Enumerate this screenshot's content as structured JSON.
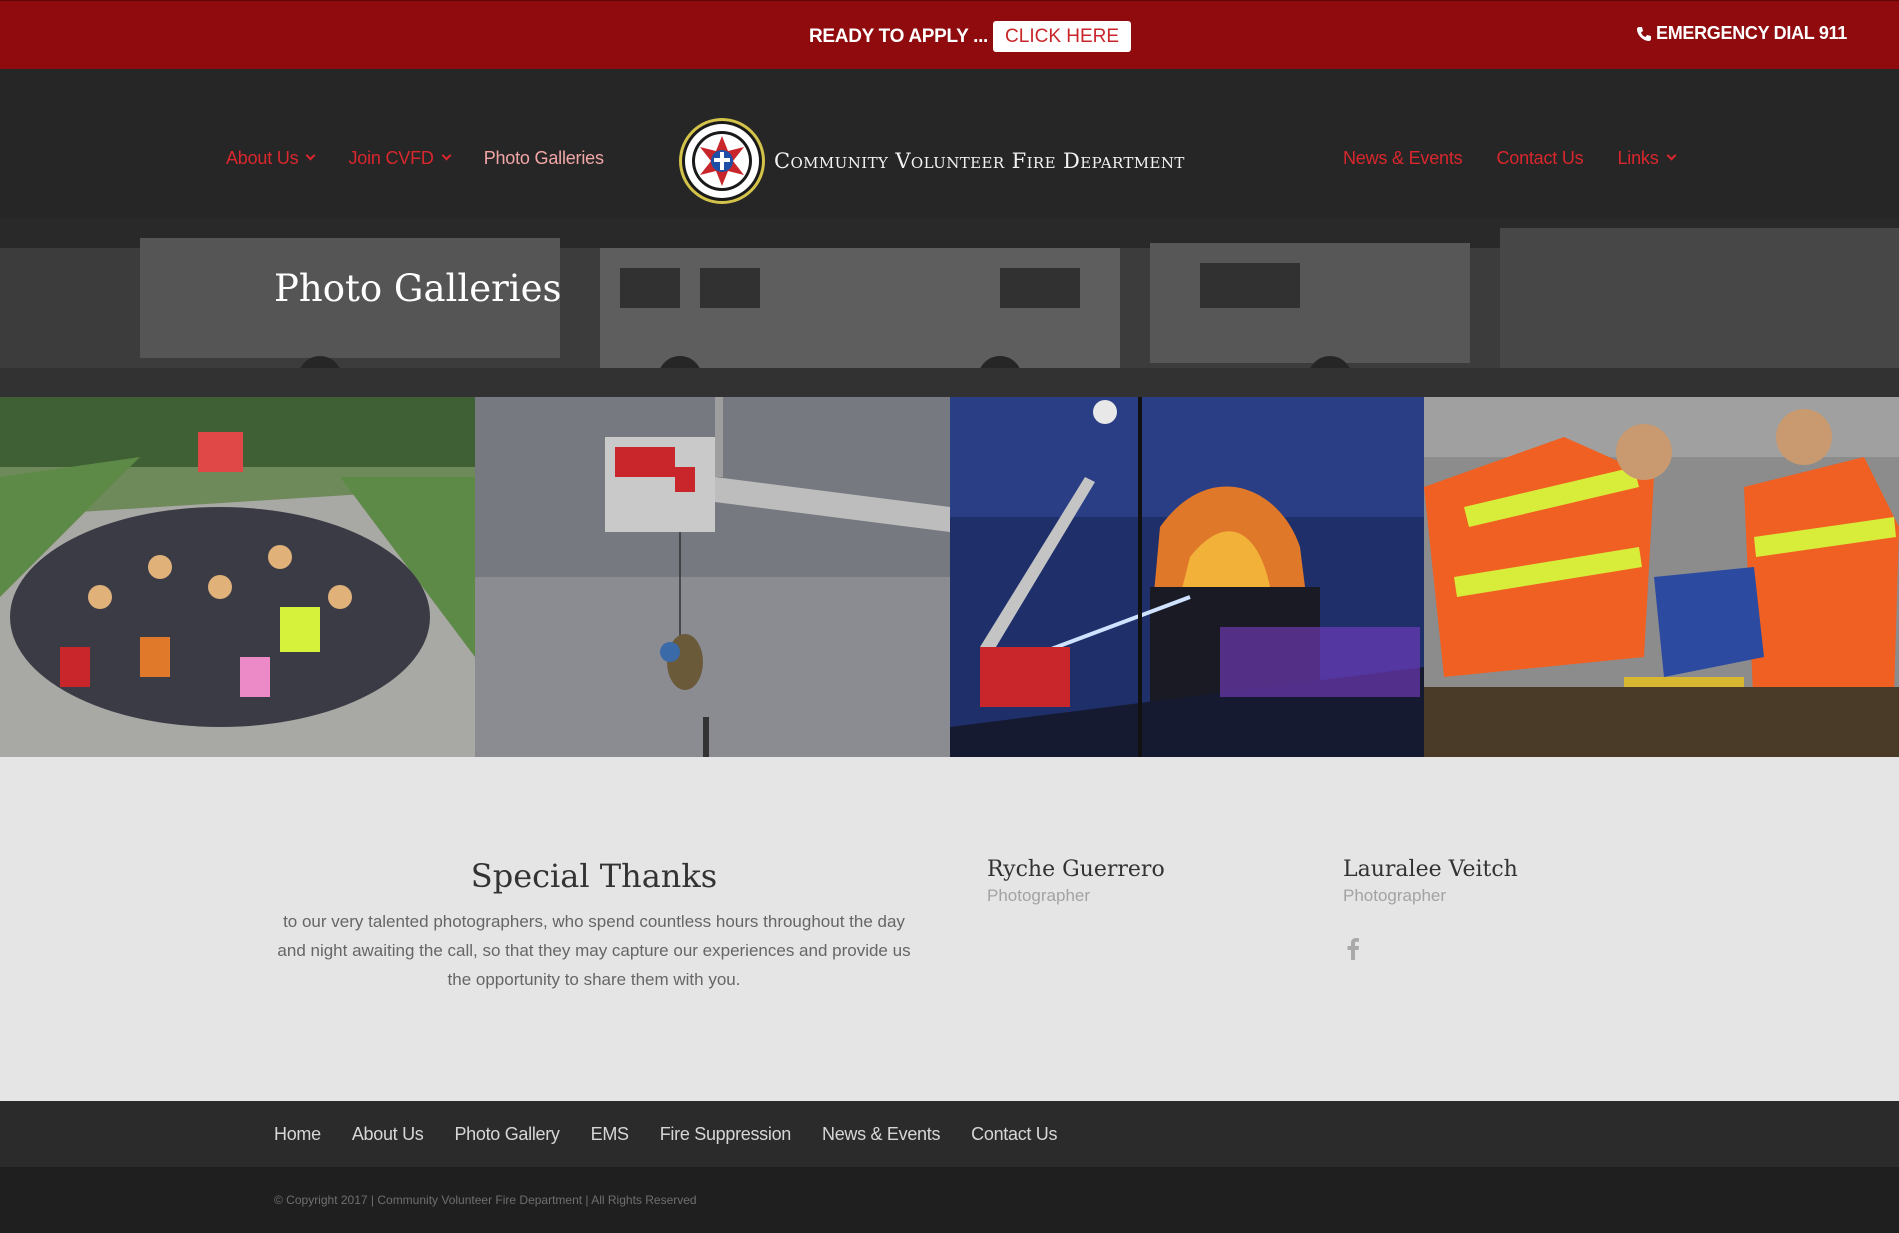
{
  "topbar": {
    "apply_text": "READY TO APPLY ...",
    "apply_button": "CLICK HERE",
    "emergency": "EMERGENCY DIAL 911"
  },
  "header": {
    "nav_left": [
      {
        "label": "About Us",
        "dropdown": true
      },
      {
        "label": "Join CVFD",
        "dropdown": true
      },
      {
        "label": "Photo Galleries",
        "dropdown": false,
        "active": true
      }
    ],
    "logo_text": "Community Volunteer Fire Department",
    "nav_right": [
      {
        "label": "News & Events",
        "dropdown": false
      },
      {
        "label": "Contact Us",
        "dropdown": false
      },
      {
        "label": "Links",
        "dropdown": true
      }
    ]
  },
  "hero": {
    "title": "Photo Galleries"
  },
  "gallery": {
    "photos": [
      {
        "name": "crowd-halloween-photo"
      },
      {
        "name": "ladder-truck-rescue-photo"
      },
      {
        "name": "night-fire-photo"
      },
      {
        "name": "ems-patient-care-photo"
      }
    ]
  },
  "thanks": {
    "title": "Special Thanks",
    "body": "to our very talented photographers, who spend countless hours throughout the day and night awaiting the call, so that they may capture our experiences and provide us the opportunity to share them with you.",
    "people": [
      {
        "name": "Ryche Guerrero",
        "role": "Photographer"
      },
      {
        "name": "Lauralee Veitch",
        "role": "Photographer",
        "social": "facebook-icon"
      }
    ]
  },
  "footer": {
    "links": [
      "Home",
      "About Us",
      "Photo Gallery",
      "EMS",
      "Fire Suppression",
      "News & Events",
      "Contact Us"
    ],
    "copyright": "© Copyright 2017  |  Community Volunteer Fire Department  |  All Rights Reserved"
  },
  "colors": {
    "topbar_bg": "#8f0b0e",
    "header_bg": "#262626",
    "nav_link": "#d9272d",
    "nav_active": "#f2a6a6"
  }
}
